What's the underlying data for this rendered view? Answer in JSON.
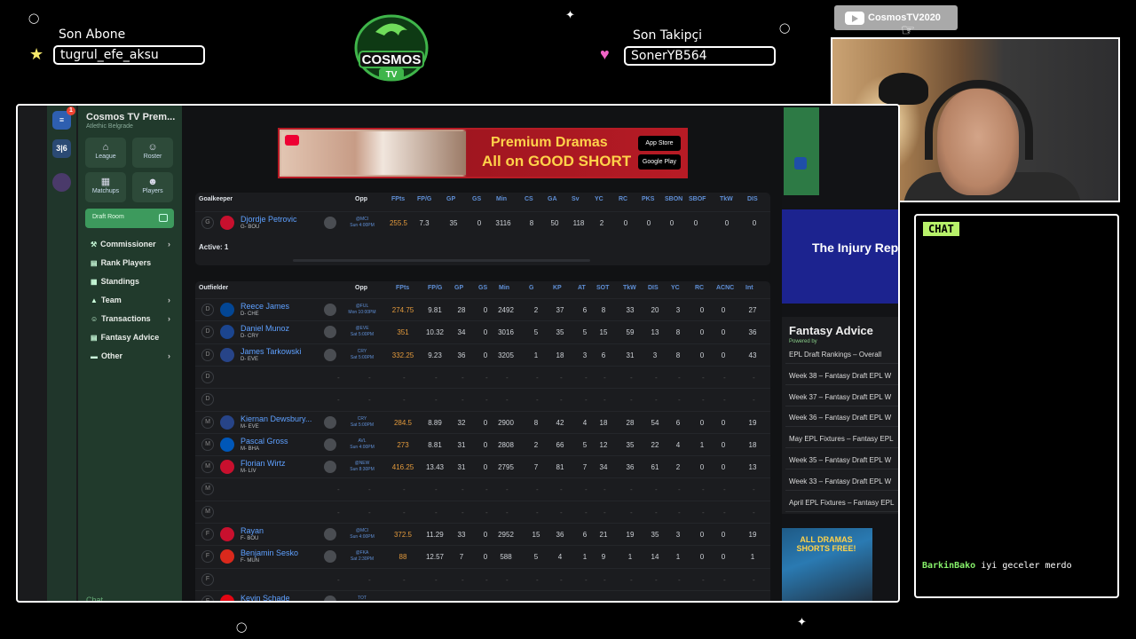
{
  "overlay": {
    "sub_label": "Son Abone",
    "sub_name": "tugrul_efe_aksu",
    "follow_label": "Son Takipçi",
    "follow_name": "SonerYB564",
    "logo_text": "COSMOS",
    "logo_sub": "TV",
    "youtube_channel": "CosmosTV2020",
    "chat_title": "CHAT",
    "chat_user": "BarkinBako",
    "chat_text": "iyi geceler merdo",
    "star_color": "#f5e86a",
    "heart_color": "#f063c6"
  },
  "rail": {
    "button1": "≡",
    "badge": "1",
    "button2": "3|6"
  },
  "nav": {
    "team_name": "Cosmos TV Prem...",
    "team_sub": "Atlethic Belgrade",
    "tiles": [
      {
        "icon": "home-icon",
        "label": "League"
      },
      {
        "icon": "users-icon",
        "label": "Roster"
      },
      {
        "icon": "calendar-icon",
        "label": "Matchups"
      },
      {
        "icon": "user-icon",
        "label": "Players"
      }
    ],
    "draft_room": "Draft Room",
    "items": [
      {
        "label": "Commissioner",
        "chevron": true
      },
      {
        "label": "Rank Players",
        "chevron": false
      },
      {
        "label": "Standings",
        "chevron": false
      },
      {
        "label": "Team",
        "chevron": true
      },
      {
        "label": "Transactions",
        "chevron": true
      },
      {
        "label": "Fantasy Advice",
        "chevron": false
      },
      {
        "label": "Other",
        "chevron": true
      }
    ],
    "footer": "Chat"
  },
  "ad": {
    "line1": "Premium Dramas",
    "line2": "All on GOOD SHORT",
    "store1": "App Store",
    "store2": "Google Play"
  },
  "goalkeeper": {
    "title": "Goalkeeper",
    "cols": [
      "Opp",
      "FPts",
      "FP/G",
      "GP",
      "GS",
      "Min",
      "CS",
      "GA",
      "Sv",
      "YC",
      "RC",
      "PKS",
      "SBON",
      "SBOF",
      "TkW",
      "DIS"
    ],
    "rows": [
      {
        "pos": "G",
        "name": "Djordje Petrovic",
        "sub": "G- BOU",
        "crest": "#c8102e",
        "opp1": "@MCI",
        "opp2": "Sun 4:00PM",
        "vals": [
          "255.5",
          "7.3",
          "35",
          "0",
          "3116",
          "8",
          "50",
          "118",
          "2",
          "0",
          "0",
          "0",
          "0",
          "0",
          "0"
        ]
      }
    ],
    "active": "Active: 1"
  },
  "outfield": {
    "title": "Outfielder",
    "cols": [
      "Opp",
      "FPts",
      "FP/G",
      "GP",
      "GS",
      "Min",
      "G",
      "KP",
      "AT",
      "SOT",
      "TkW",
      "DIS",
      "YC",
      "RC",
      "ACNC",
      "Int"
    ],
    "rows": [
      {
        "pos": "D",
        "name": "Reece James",
        "sub": "D- CHE",
        "crest": "#034694",
        "opp1": "@FUL",
        "opp2": "Mon 10:00PM",
        "vals": [
          "274.75",
          "9.81",
          "28",
          "0",
          "2492",
          "2",
          "37",
          "6",
          "8",
          "33",
          "20",
          "3",
          "0",
          "0",
          "27"
        ]
      },
      {
        "pos": "D",
        "name": "Daniel Munoz",
        "sub": "D- CRY",
        "crest": "#1b458f",
        "opp1": "@EVE",
        "opp2": "Sat 5:00PM",
        "vals": [
          "351",
          "10.32",
          "34",
          "0",
          "3016",
          "5",
          "35",
          "5",
          "15",
          "59",
          "13",
          "8",
          "0",
          "0",
          "36"
        ]
      },
      {
        "pos": "D",
        "name": "James Tarkowski",
        "sub": "D- EVE",
        "crest": "#274488",
        "opp1": "CRY",
        "opp2": "Sat 5:00PM",
        "vals": [
          "332.25",
          "9.23",
          "36",
          "0",
          "3205",
          "1",
          "18",
          "3",
          "6",
          "31",
          "3",
          "8",
          "0",
          "0",
          "43"
        ]
      },
      {
        "pos": "D",
        "empty": true
      },
      {
        "pos": "D",
        "empty": true
      },
      {
        "pos": "M",
        "name": "Kiernan Dewsbury...",
        "sub": "M- EVE",
        "crest": "#274488",
        "opp1": "CRY",
        "opp2": "Sat 5:00PM",
        "vals": [
          "284.5",
          "8.89",
          "32",
          "0",
          "2900",
          "8",
          "42",
          "4",
          "18",
          "28",
          "54",
          "6",
          "0",
          "0",
          "19"
        ]
      },
      {
        "pos": "M",
        "name": "Pascal Gross",
        "sub": "M- BHA",
        "crest": "#0057b8",
        "opp1": "AVL",
        "opp2": "Sun 4:00PM",
        "vals": [
          "273",
          "8.81",
          "31",
          "0",
          "2808",
          "2",
          "66",
          "5",
          "12",
          "35",
          "22",
          "4",
          "1",
          "0",
          "18"
        ]
      },
      {
        "pos": "M",
        "name": "Florian Wirtz",
        "sub": "M- LIV",
        "crest": "#c8102e",
        "opp1": "@NEW",
        "opp2": "Sun 8:30PM",
        "vals": [
          "416.25",
          "13.43",
          "31",
          "0",
          "2795",
          "7",
          "81",
          "7",
          "34",
          "36",
          "61",
          "2",
          "0",
          "0",
          "13"
        ]
      },
      {
        "pos": "M",
        "empty": true
      },
      {
        "pos": "M",
        "empty": true
      },
      {
        "pos": "F",
        "name": "Rayan",
        "sub": "F- BOU",
        "crest": "#c8102e",
        "opp1": "@MCI",
        "opp2": "Sun 4:00PM",
        "vals": [
          "372.5",
          "11.29",
          "33",
          "0",
          "2952",
          "15",
          "36",
          "6",
          "21",
          "19",
          "35",
          "3",
          "0",
          "0",
          "19"
        ]
      },
      {
        "pos": "F",
        "name": "Benjamin Sesko",
        "sub": "F- MUN",
        "crest": "#da291c",
        "opp1": "@FKA",
        "opp2": "Sat 2:30PM",
        "vals": [
          "88",
          "12.57",
          "7",
          "0",
          "588",
          "5",
          "4",
          "1",
          "9",
          "1",
          "14",
          "1",
          "0",
          "0",
          "1"
        ]
      },
      {
        "pos": "F",
        "empty": true
      },
      {
        "pos": "F",
        "name": "Kevin Schade",
        "sub": "",
        "crest": "#e30613",
        "opp1": "TOT",
        "opp2": "",
        "vals": [
          "",
          "",
          "",
          "",
          "",
          "",
          "",
          "",
          "",
          "",
          "",
          "",
          "",
          "",
          ""
        ]
      }
    ]
  },
  "right": {
    "injury": "The Injury Rep",
    "fa_title": "Fantasy Advice",
    "fa_powered": "Powered by",
    "fa_items": [
      "EPL Draft Rankings – Overall",
      "Week 38 – Fantasy Draft EPL W",
      "Week 37 – Fantasy Draft EPL W",
      "Week 36 – Fantasy Draft EPL W",
      "May EPL Fixtures – Fantasy EPL",
      "Week 35 – Fantasy Draft EPL W",
      "Week 33 – Fantasy Draft EPL W",
      "April EPL Fixtures – Fantasy EPL"
    ],
    "shorts_text": "ALL DRAMAS SHORTS FREE!"
  }
}
